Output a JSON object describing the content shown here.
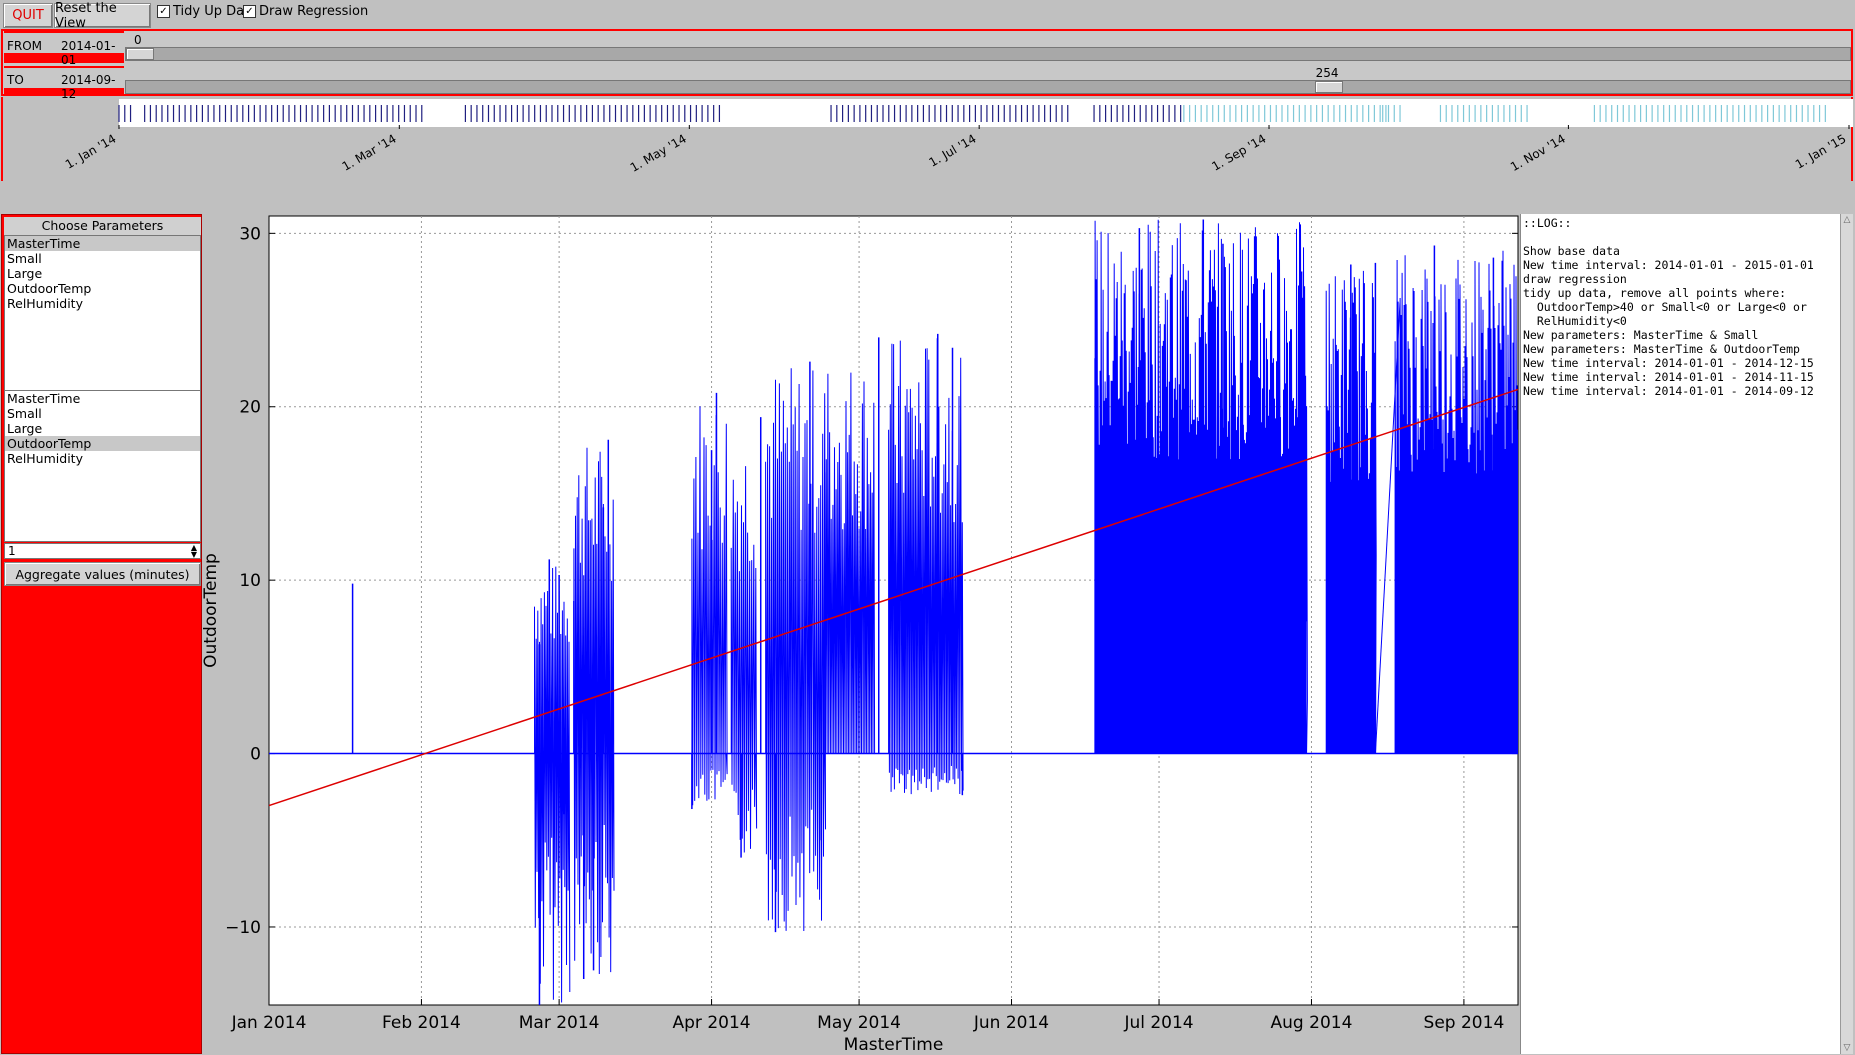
{
  "toolbar": {
    "quit_label": "QUIT",
    "reset_label": "Reset the View",
    "tidy_label": "Tidy Up Data",
    "tidy_checked": true,
    "regression_label": "Draw Regression",
    "regression_checked": true
  },
  "range": {
    "from_label": "FROM",
    "from_value": "2014-01-01",
    "from_slider_value": "0",
    "to_label": "TO",
    "to_value": "2014-09-12",
    "to_slider_value": "254",
    "from_fraction": 0,
    "to_fraction": 0.7
  },
  "timeline": {
    "ticks": [
      "1. Jan '14",
      "1. Mar '14",
      "1. May '14",
      "1. Jul '14",
      "1. Sep '14",
      "1. Nov '14",
      "1. Jan '15"
    ]
  },
  "params": {
    "title": "Choose Parameters",
    "x_list": [
      "MasterTime",
      "Small",
      "Large",
      "OutdoorTemp",
      "RelHumidity"
    ],
    "x_selected": 0,
    "y_list": [
      "MasterTime",
      "Small",
      "Large",
      "OutdoorTemp",
      "RelHumidity"
    ],
    "y_selected": 3,
    "spin_value": "1",
    "aggregate_label": "Aggregate values (minutes)"
  },
  "chart_data": {
    "type": "line",
    "xlabel": "MasterTime",
    "ylabel": "OutdoorTemp",
    "x_ticks": [
      "Jan 2014",
      "Feb 2014",
      "Mar 2014",
      "Apr 2014",
      "May 2014",
      "Jun 2014",
      "Jul 2014",
      "Aug 2014",
      "Sep 2014"
    ],
    "y_ticks": [
      "30",
      "20",
      "10",
      "0",
      "−10"
    ],
    "ylim": [
      -14.5,
      31
    ],
    "xlim": [
      "2014-01-01",
      "2014-09-12"
    ],
    "grid": true,
    "series_color": "#0000ff",
    "regression_color": "#dd0000",
    "regression": {
      "start": -3,
      "end": 21
    },
    "series": [
      {
        "values": [
          {
            "x": "2014-01-18",
            "y": 9.8
          },
          {
            "x": "2014-02-25",
            "y": 6.3
          },
          {
            "x": "2014-02-25",
            "y": -14.5
          },
          {
            "x": "2014-02-27",
            "y": 11.2
          },
          {
            "x": "2014-02-28",
            "y": -4.6
          },
          {
            "x": "2014-03-01",
            "y": 10.3
          },
          {
            "x": "2014-03-02",
            "y": -3.5
          },
          {
            "x": "2014-03-04",
            "y": 8.8
          },
          {
            "x": "2014-03-06",
            "y": -13
          },
          {
            "x": "2014-03-08",
            "y": -12.5
          },
          {
            "x": "2014-03-10",
            "y": 14.2
          },
          {
            "x": "2014-03-11",
            "y": 18.1
          },
          {
            "x": "2014-03-28",
            "y": -3.2
          },
          {
            "x": "2014-04-01",
            "y": 17.5
          },
          {
            "x": "2014-04-02",
            "y": 20.8
          },
          {
            "x": "2014-04-07",
            "y": -6
          },
          {
            "x": "2014-04-11",
            "y": 19.4
          },
          {
            "x": "2014-04-14",
            "y": -10.3
          },
          {
            "x": "2014-04-21",
            "y": 22.6
          },
          {
            "x": "2014-04-23",
            "y": -5
          },
          {
            "x": "2014-05-05",
            "y": 24
          },
          {
            "x": "2014-05-17",
            "y": 24.2
          },
          {
            "x": "2014-05-20",
            "y": 23.4
          },
          {
            "x": "2014-05-22",
            "y": -2.4
          },
          {
            "x": "2014-06-18",
            "y": 22.8
          },
          {
            "x": "2014-06-27",
            "y": 30.3
          },
          {
            "x": "2014-07-10",
            "y": 30.8
          },
          {
            "x": "2014-07-14",
            "y": 29.4
          },
          {
            "x": "2014-07-30",
            "y": 27.8
          },
          {
            "x": "2014-08-09",
            "y": 28.2
          },
          {
            "x": "2014-08-14",
            "y": 28.3
          },
          {
            "x": "2014-08-26",
            "y": 29.3
          },
          {
            "x": "2014-09-07",
            "y": 28.6
          },
          {
            "x": "2014-09-12",
            "y": 16.3
          }
        ]
      }
    ]
  },
  "log": {
    "lines": [
      "::LOG::",
      "",
      "Show base data",
      "New time interval: 2014-01-01 - 2015-01-01",
      "draw regression",
      "tidy up data, remove all points where:",
      "  OutdoorTemp>40 or Small<0 or Large<0 or",
      "  RelHumidity<0",
      "New parameters: MasterTime & Small",
      "New parameters: MasterTime & OutdoorTemp",
      "New time interval: 2014-01-01 - 2014-12-15",
      "New time interval: 2014-01-01 - 2014-11-15",
      "New time interval: 2014-01-01 - 2014-09-12"
    ]
  },
  "colors": {
    "accent_red": "#ff0000",
    "data_blue": "#0000ff"
  }
}
